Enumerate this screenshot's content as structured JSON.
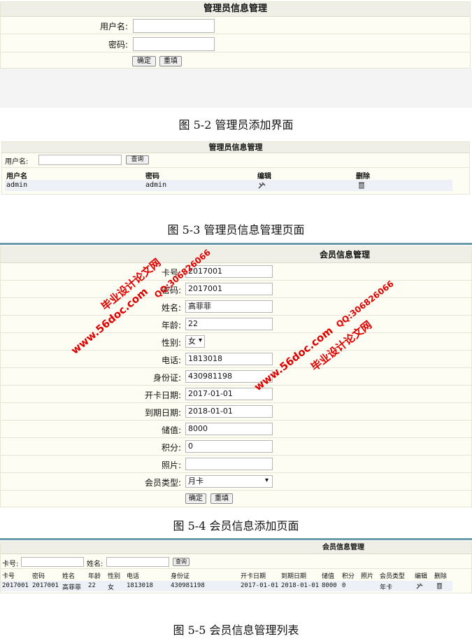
{
  "fig2": {
    "title": "管理员信息管理",
    "username_label": "用户名:",
    "password_label": "密码:",
    "confirm_label": "确定",
    "reset_label": "重填",
    "caption": "图 5-2 管理员添加界面"
  },
  "fig3": {
    "title": "管理员信息管理",
    "search_label": "用户名:",
    "query_label": "查询",
    "columns": [
      "用户名",
      "密码",
      "编辑",
      "删除"
    ],
    "row": {
      "username": "admin",
      "password": "admin"
    },
    "caption": "图 5-3 管理员信息管理页面"
  },
  "fig4": {
    "title": "会员信息管理",
    "fields": [
      {
        "label": "卡号:",
        "value": "2017001"
      },
      {
        "label": "密码:",
        "value": "2017001"
      },
      {
        "label": "姓名:",
        "value": "高菲菲"
      },
      {
        "label": "年龄:",
        "value": "22"
      },
      {
        "label": "性别:",
        "value": "女"
      },
      {
        "label": "电话:",
        "value": "1813018"
      },
      {
        "label": "身份证:",
        "value": "430981198"
      },
      {
        "label": "开卡日期:",
        "value": "2017-01-01"
      },
      {
        "label": "到期日期:",
        "value": "2018-01-01"
      },
      {
        "label": "储值:",
        "value": "8000"
      },
      {
        "label": "积分:",
        "value": "0"
      },
      {
        "label": "照片:",
        "value": ""
      },
      {
        "label": "会员类型:",
        "value": "月卡"
      }
    ],
    "confirm_label": "确定",
    "reset_label": "重填",
    "caption": "图 5-4 会员信息添加页面"
  },
  "fig5": {
    "title": "会员信息管理",
    "search_card_label": "卡号:",
    "search_name_label": "姓名:",
    "query_label": "查询",
    "columns": [
      "卡号",
      "密码",
      "姓名",
      "年龄",
      "性别",
      "电话",
      "身份证",
      "开卡日期",
      "到期日期",
      "储值",
      "积分",
      "照片",
      "会员类型",
      "编辑",
      "删除"
    ],
    "row": [
      "2017001",
      "2017001",
      "高菲菲",
      "22",
      "女",
      "1813018",
      "430981198",
      "2017-01-01",
      "2018-01-01",
      "8000",
      "0",
      "",
      "年卡"
    ],
    "caption": "图 5-5 会员信息管理列表"
  },
  "watermarks": {
    "site": "www.56doc.com",
    "name": "毕业设计论文网",
    "qq": "QQ:306826066"
  },
  "colors": {
    "watermark": "#e00000",
    "divider": "#6d9aa8",
    "header": "#efefe7",
    "panel": "#fdfdf3"
  }
}
